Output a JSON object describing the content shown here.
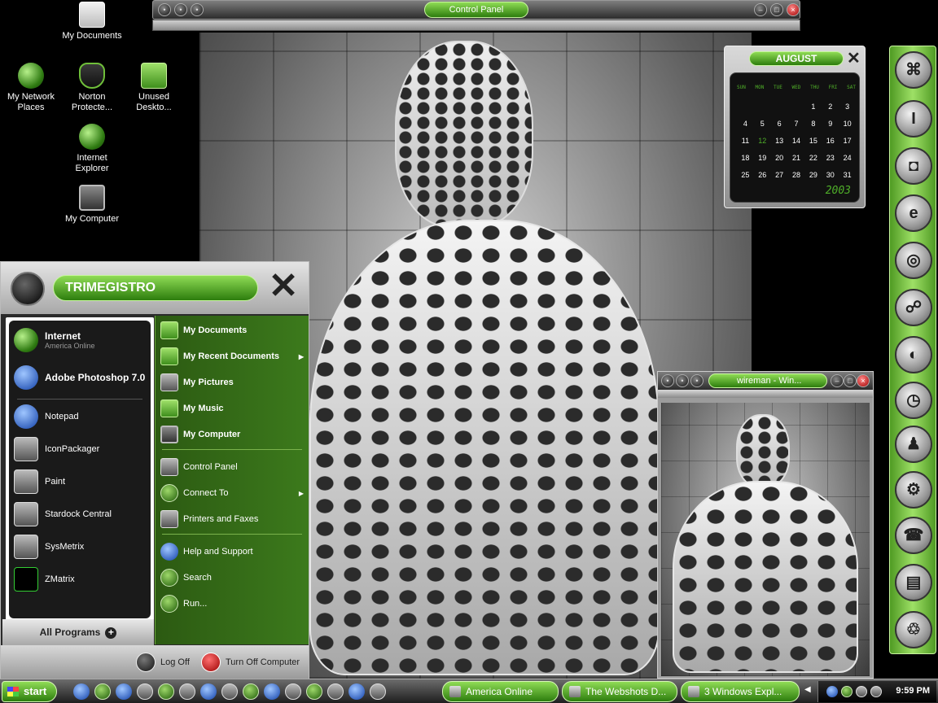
{
  "desktop": {
    "icons": [
      {
        "label": "My Documents",
        "icon": "folder-icon"
      },
      {
        "label": "My Network Places",
        "icon": "network-icon"
      },
      {
        "label": "Norton Protecte...",
        "icon": "shield-icon"
      },
      {
        "label": "Unused Deskto...",
        "icon": "folder-icon"
      },
      {
        "label": "Internet Explorer",
        "icon": "globe-icon"
      },
      {
        "label": "My Computer",
        "icon": "computer-icon"
      }
    ]
  },
  "control_panel": {
    "title": "Control Panel"
  },
  "calendar": {
    "month": "AUGUST",
    "weekdays": [
      "SUN",
      "MON",
      "TUE",
      "WED",
      "THU",
      "FRI",
      "SAT"
    ],
    "days": [
      "",
      "",
      "",
      "",
      "1",
      "2",
      "3",
      "4",
      "5",
      "6",
      "7",
      "8",
      "9",
      "10",
      "11",
      "12",
      "13",
      "14",
      "15",
      "16",
      "17",
      "18",
      "19",
      "20",
      "21",
      "22",
      "23",
      "24",
      "25",
      "26",
      "27",
      "28",
      "29",
      "30",
      "31"
    ],
    "today": "12",
    "year": "2003"
  },
  "start_menu": {
    "user": "TRIMEGISTRO",
    "pinned": [
      {
        "title": "Internet",
        "subtitle": "America Online"
      },
      {
        "title": "Adobe Photoshop 7.0"
      }
    ],
    "recent": [
      "Notepad",
      "IconPackager",
      "Paint",
      "Stardock Central",
      "SysMetrix",
      "ZMatrix"
    ],
    "all_programs": "All Programs",
    "right": [
      {
        "label": "My Documents"
      },
      {
        "label": "My Recent Documents",
        "has_arrow": true
      },
      {
        "label": "My Pictures"
      },
      {
        "label": "My Music"
      },
      {
        "label": "My Computer"
      },
      {
        "label": "Control Panel"
      },
      {
        "label": "Connect To",
        "has_arrow": true
      },
      {
        "label": "Printers and Faxes"
      },
      {
        "label": "Help and Support"
      },
      {
        "label": "Search"
      },
      {
        "label": "Run..."
      }
    ],
    "log_off": "Log Off",
    "turn_off": "Turn Off Computer"
  },
  "wireman_window": {
    "title": "wireman - Win..."
  },
  "taskbar": {
    "start": "start",
    "tasks": [
      {
        "label": "America  Online"
      },
      {
        "label": "The Webshots D..."
      },
      {
        "label": "3 Windows Expl..."
      }
    ],
    "clock": "9:59 PM"
  },
  "colors": {
    "accent": "#3c7a1c",
    "accent_light": "#8fdc55",
    "calendar_text": "#4fae29"
  }
}
